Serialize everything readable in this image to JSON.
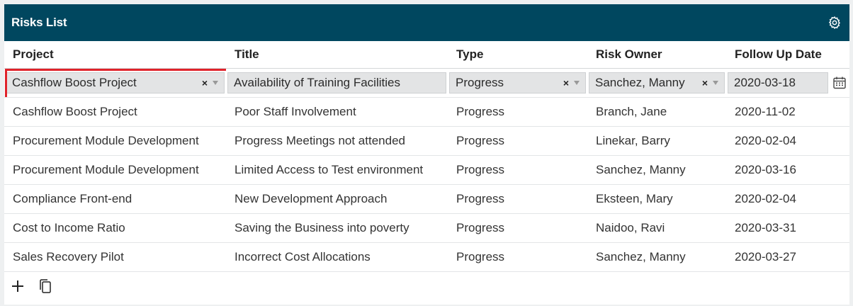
{
  "panel": {
    "title": "Risks List",
    "settings_icon": "gear-icon"
  },
  "columns": [
    "Project",
    "Title",
    "Type",
    "Risk Owner",
    "Follow Up Date"
  ],
  "edit_row": {
    "project": "Cashflow Boost Project",
    "title": "Availability of Training Facilities",
    "type": "Progress",
    "owner": "Sanchez, Manny",
    "date": "2020-03-18",
    "clear_glyph": "×"
  },
  "rows": [
    [
      "Cashflow Boost Project",
      "Poor Staff Involvement",
      "Progress",
      "Branch, Jane",
      "2020-11-02"
    ],
    [
      "Procurement Module Development",
      "Progress Meetings not attended",
      "Progress",
      "Linekar, Barry",
      "2020-02-04"
    ],
    [
      "Procurement Module Development",
      "Limited Access to Test environment",
      "Progress",
      "Sanchez, Manny",
      "2020-03-16"
    ],
    [
      "Compliance Front-end",
      "New Development Approach",
      "Progress",
      "Eksteen, Mary",
      "2020-02-04"
    ],
    [
      "Cost to Income Ratio",
      "Saving the Business into poverty",
      "Progress",
      "Naidoo, Ravi",
      "2020-03-31"
    ],
    [
      "Sales Recovery Pilot",
      "Incorrect Cost Allocations",
      "Progress",
      "Sanchez, Manny",
      "2020-03-27"
    ]
  ],
  "footer": {
    "add_icon": "plus-icon",
    "copy_icon": "copy-icon"
  },
  "colors": {
    "header_bg": "#00475f",
    "selection_border": "#e0232b"
  }
}
